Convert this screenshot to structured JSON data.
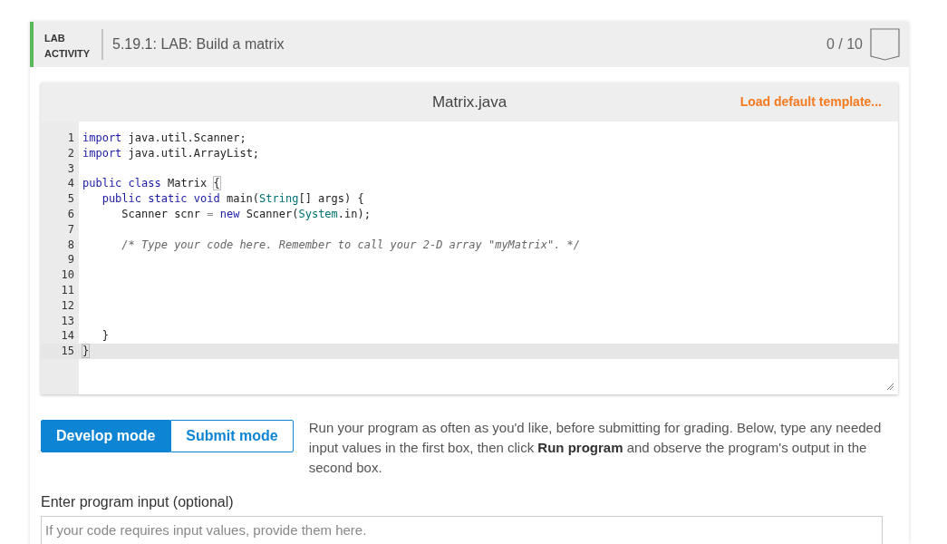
{
  "activity": {
    "type_label": "LAB ACTIVITY",
    "title": "5.19.1: LAB: Build a matrix",
    "score": "0 / 10"
  },
  "editor": {
    "filename": "Matrix.java",
    "template_link": "Load default template...",
    "lines": [
      {
        "number": "1",
        "active": false,
        "tokens": [
          {
            "kind": "keyword",
            "text": "import"
          },
          {
            "kind": "plain",
            "text": " java.util.Scanner;"
          }
        ]
      },
      {
        "number": "2",
        "active": false,
        "tokens": [
          {
            "kind": "keyword",
            "text": "import"
          },
          {
            "kind": "plain",
            "text": " java.util.ArrayList;"
          }
        ]
      },
      {
        "number": "3",
        "active": false
      },
      {
        "number": "4",
        "active": false,
        "tokens": [
          {
            "kind": "keyword",
            "text": "public class"
          },
          {
            "kind": "plain",
            "text": " Matrix "
          },
          {
            "kind": "bracket-match",
            "text": "{"
          }
        ]
      },
      {
        "number": "5",
        "active": false,
        "tokens": [
          {
            "kind": "keyword",
            "text": "   public static void"
          },
          {
            "kind": "plain",
            "text": " main("
          },
          {
            "kind": "type",
            "text": "String"
          },
          {
            "kind": "plain",
            "text": "[] args) {"
          }
        ]
      },
      {
        "number": "6",
        "active": false,
        "tokens": [
          {
            "kind": "plain",
            "text": "      Scanner scnr "
          },
          {
            "kind": "operator",
            "text": "="
          },
          {
            "kind": "keyword",
            "text": " new"
          },
          {
            "kind": "plain",
            "text": " Scanner("
          },
          {
            "kind": "type",
            "text": "System"
          },
          {
            "kind": "plain",
            "text": ".in);"
          }
        ]
      },
      {
        "number": "7",
        "active": false
      },
      {
        "number": "8",
        "active": false,
        "tokens": [
          {
            "kind": "comment",
            "text": "      /* Type your code here. Remember to call your 2-D array \"myMatrix\". */"
          }
        ]
      },
      {
        "number": "9",
        "active": false
      },
      {
        "number": "10",
        "active": false
      },
      {
        "number": "11",
        "active": false
      },
      {
        "number": "12",
        "active": false
      },
      {
        "number": "13",
        "active": false
      },
      {
        "number": "14",
        "active": false,
        "tokens": [
          {
            "kind": "plain",
            "text": "   }"
          }
        ]
      },
      {
        "number": "15",
        "active": true,
        "tokens": [
          {
            "kind": "bracket-match",
            "text": "}"
          }
        ]
      }
    ]
  },
  "modes": [
    {
      "label": "Develop mode",
      "selected": true
    },
    {
      "label": "Submit mode",
      "selected": false
    }
  ],
  "instructions": "Run your program as often as you'd like, before submitting for grading. Below, type any needed input values in the first box, then click **Run program** and observe the program's output in the second box.",
  "input": {
    "label": "Enter program input (optional)",
    "placeholder": "If your code requires input values, provide them here."
  }
}
